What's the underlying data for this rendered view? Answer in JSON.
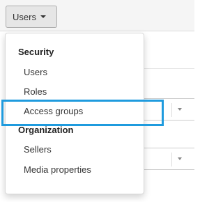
{
  "toolbar": {
    "users_button_label": "Users"
  },
  "menu": {
    "sections": [
      {
        "header": "Security",
        "items": [
          "Users",
          "Roles",
          "Access groups"
        ]
      },
      {
        "header": "Organization",
        "items": [
          "Sellers",
          "Media properties"
        ]
      }
    ],
    "highlighted_item": "Access groups",
    "highlight_color": "#1f9bde"
  }
}
